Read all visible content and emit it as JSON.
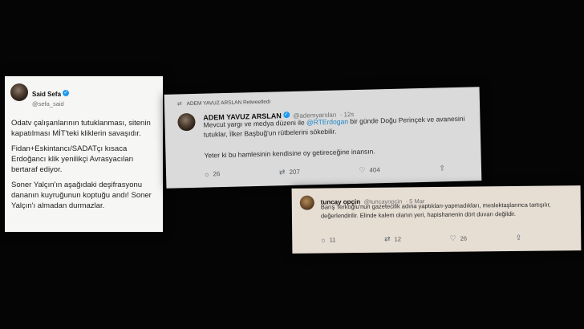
{
  "tweet1": {
    "name": "Said Sefa",
    "handle": "@sefa_said",
    "paragraphs": [
      "Odatv çalışanlarının tutuklanması, sitenin kapatılması MİT'teki kliklerin savaşıdır.",
      "Fidan+Eskintancı/SADATçı kısaca Erdoğancı klik yenilikçi Avrasyacıları bertaraf ediyor.",
      "Soner Yalçın'ın aşağıdaki deşifrasyonu dananın kuyruğunun koptuğu andı! Soner Yalçın'ı almadan durmazlar."
    ]
  },
  "tweet2": {
    "retweet_label": "ADEM YAVUZ ARSLAN Retweetledi",
    "name": "ADEM YAVUZ ARSLAN",
    "handle": "@ademyarslan",
    "time": "· 12s",
    "text_before": "Mevcut yargı ve medya düzeni ile ",
    "mention": "@RTErdogan",
    "text_after": " bir günde Doğu Perinçek ve avanesini tutuklar, İlker Başbuğ'un rütbelerini sökebilir.",
    "text2": "Yeter ki bu hamlesinin kendisine oy getireceğine inansın.",
    "replies": "26",
    "retweets": "207",
    "likes": "404"
  },
  "tweet3": {
    "name": "tuncay opçin",
    "handle": "@tuncayopcin",
    "time": "· 5 Mar",
    "text": "Barış Terkoğlu'nun gazetecilik adına yaptıkları-yapmadıkları, meslektaşlarınca tartışılır, değerlendirilir. Elinde kalem olanın yeri, hapishanenin dört duvarı değildir.",
    "replies": "11",
    "retweets": "12",
    "likes": "26"
  }
}
